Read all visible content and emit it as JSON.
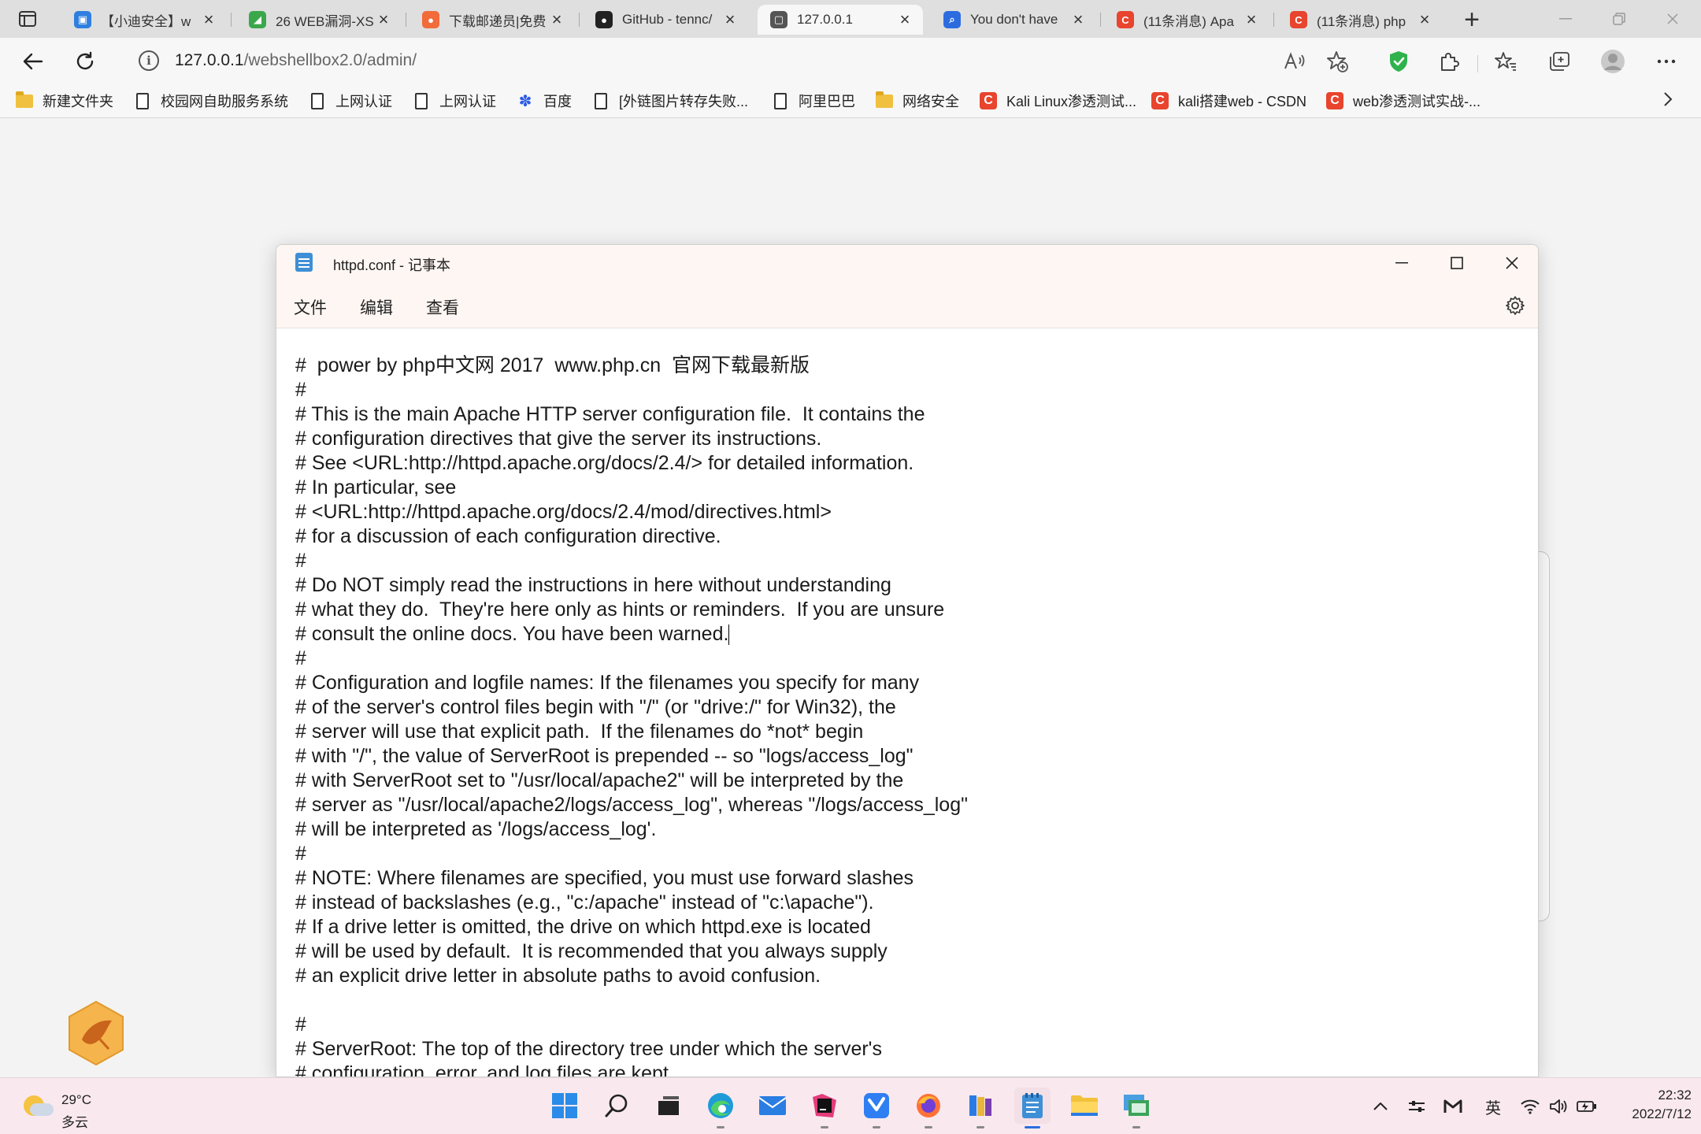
{
  "browser": {
    "tabs": [
      {
        "title": "【小迪安全】w",
        "icon_color": "#2f7fe0",
        "icon_glyph": "▣"
      },
      {
        "title": "26 WEB漏洞-XS",
        "icon_color": "#3aa84a",
        "icon_glyph": "◢"
      },
      {
        "title": "下载邮递员|免费",
        "icon_color": "#f26b3a",
        "icon_glyph": "●"
      },
      {
        "title": "GitHub - tennc/",
        "icon_color": "#222222",
        "icon_glyph": "●"
      },
      {
        "title": "127.0.0.1",
        "icon_color": "#555555",
        "icon_glyph": "▢"
      },
      {
        "title": "You don't have",
        "icon_color": "#2d6cdf",
        "icon_glyph": "⌕"
      },
      {
        "title": "(11条消息) Apa",
        "icon_color": "#e8442e",
        "icon_glyph": "C"
      },
      {
        "title": "(11条消息) php",
        "icon_color": "#e8442e",
        "icon_glyph": "C"
      }
    ],
    "active_tab_index": 4,
    "address": {
      "host": "127.0.0.1",
      "path": "/webshellbox2.0/admin/"
    },
    "bookmarks": [
      {
        "label": "新建文件夹",
        "icon": "folder-icon"
      },
      {
        "label": "校园网自助服务系统",
        "icon": "page-icon"
      },
      {
        "label": "上网认证",
        "icon": "page-icon"
      },
      {
        "label": "上网认证",
        "icon": "page-icon"
      },
      {
        "label": "百度",
        "icon": "baidu-paw-icon"
      },
      {
        "label": "[外链图片转存失败...",
        "icon": "page-icon"
      },
      {
        "label": "阿里巴巴",
        "icon": "page-icon"
      },
      {
        "label": "网络安全",
        "icon": "folder-icon"
      },
      {
        "label": "Kali Linux渗透测试...",
        "icon": "csdn-icon"
      },
      {
        "label": "kali搭建web - CSDN",
        "icon": "csdn-icon"
      },
      {
        "label": "web渗透测试实战-...",
        "icon": "csdn-icon"
      }
    ]
  },
  "notepad": {
    "title": "httpd.conf - 记事本",
    "menus": [
      "文件",
      "编辑",
      "查看"
    ],
    "lines": [
      "#  power by php中文网 2017  www.php.cn  官网下载最新版",
      "#",
      "# This is the main Apache HTTP server configuration file.  It contains the",
      "# configuration directives that give the server its instructions.",
      "# See <URL:http://httpd.apache.org/docs/2.4/> for detailed information.",
      "# In particular, see",
      "# <URL:http://httpd.apache.org/docs/2.4/mod/directives.html>",
      "# for a discussion of each configuration directive.",
      "#",
      "# Do NOT simply read the instructions in here without understanding",
      "# what they do.  They're here only as hints or reminders.  If you are unsure",
      "# consult the online docs. You have been warned.",
      "#",
      "# Configuration and logfile names: If the filenames you specify for many",
      "# of the server's control files begin with \"/\" (or \"drive:/\" for Win32), the",
      "# server will use that explicit path.  If the filenames do *not* begin",
      "# with \"/\", the value of ServerRoot is prepended -- so \"logs/access_log\"",
      "# with ServerRoot set to \"/usr/local/apache2\" will be interpreted by the",
      "# server as \"/usr/local/apache2/logs/access_log\", whereas \"/logs/access_log\"",
      "# will be interpreted as '/logs/access_log'.",
      "#",
      "# NOTE: Where filenames are specified, you must use forward slashes",
      "# instead of backslashes (e.g., \"c:/apache\" instead of \"c:\\apache\").",
      "# If a drive letter is omitted, the drive on which httpd.exe is located",
      "# will be used by default.  It is recommended that you always supply",
      "# an explicit drive letter in absolute paths to avoid confusion.",
      "",
      "#",
      "# ServerRoot: The top of the directory tree under which the server's",
      "# configuration, error, and log files are kept."
    ],
    "caret_line_index": 11
  },
  "taskbar": {
    "weather": {
      "temp": "29°C",
      "condition": "多云"
    },
    "tray_ime": "英",
    "time": "22:32",
    "date": "2022/7/12"
  }
}
